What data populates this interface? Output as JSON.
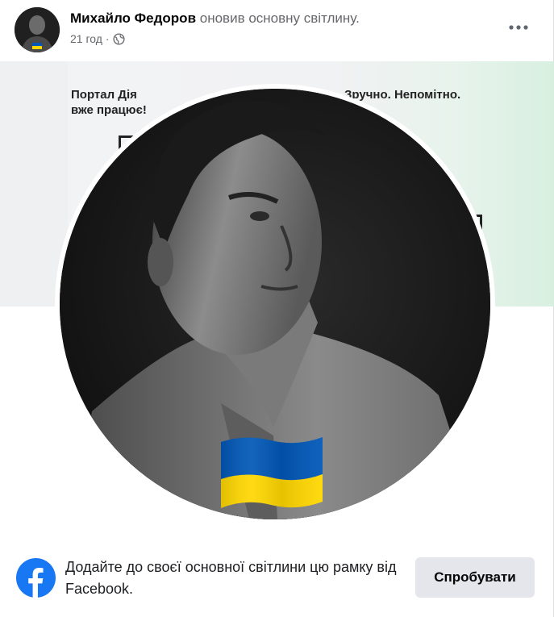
{
  "post": {
    "author": "Михайло Федоров",
    "action": "оновив основну світлину.",
    "time": "21 год",
    "separator": "·",
    "privacy_icon": "globe-icon",
    "more_icon": "more-horizontal-icon"
  },
  "cover": {
    "left_text": "Портал Дія\nвже працює!",
    "right_text": "Зручно. Непомітно.\nяно."
  },
  "frame": {
    "flag_colors": [
      "#0057b7",
      "#ffd700"
    ]
  },
  "footer": {
    "logo_icon": "facebook-logo-icon",
    "text": "Додайте до своєї основної світлини цю рамку від Facebook.",
    "button_label": "Спробувати",
    "logo_color": "#1877f2"
  }
}
